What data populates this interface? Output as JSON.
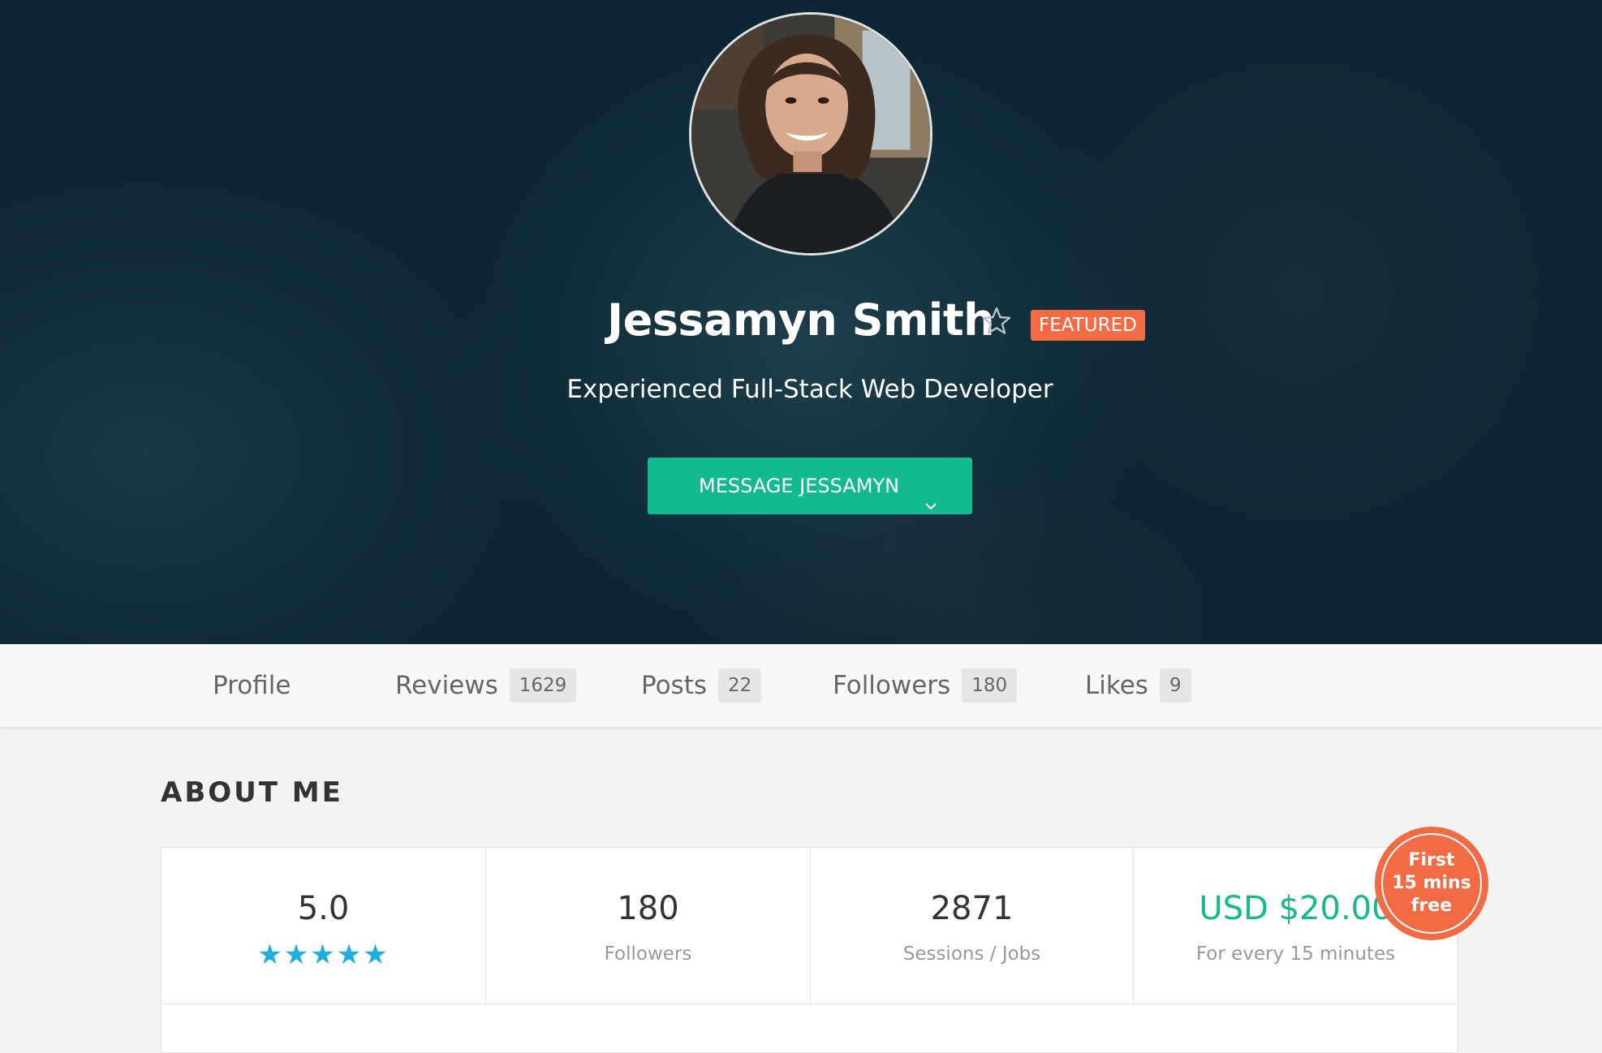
{
  "profile": {
    "name": "Jessamyn Smith",
    "badge": "FEATURED",
    "headline": "Experienced Full-Stack Web Developer",
    "message_button": "MESSAGE JESSAMYN",
    "avatar_icon": "person-photo",
    "favorite_icon": "star-outline-icon"
  },
  "tabs": [
    {
      "label": "Profile",
      "count": null
    },
    {
      "label": "Reviews",
      "count": "1629"
    },
    {
      "label": "Posts",
      "count": "22"
    },
    {
      "label": "Followers",
      "count": "180"
    },
    {
      "label": "Likes",
      "count": "9"
    }
  ],
  "about": {
    "title": "ABOUT ME",
    "stats": [
      {
        "value": "5.0",
        "label": "",
        "stars": "★★★★★"
      },
      {
        "value": "180",
        "label": "Followers"
      },
      {
        "value": "2871",
        "label": "Sessions / Jobs"
      },
      {
        "value": "USD $20.00",
        "label": "For every 15 minutes"
      }
    ],
    "rating_stars": 5,
    "promo": [
      "First",
      "15 mins",
      "free"
    ]
  },
  "colors": {
    "accent_green": "#13b98f",
    "featured_orange": "#f26b45",
    "star_blue": "#1eaee0",
    "hero_bg": "#0c2633"
  }
}
